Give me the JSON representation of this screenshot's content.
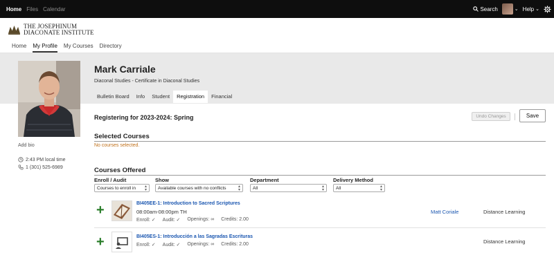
{
  "topbar": {
    "nav": [
      "Home",
      "Files",
      "Calendar"
    ],
    "search_label": "Search",
    "help_label": "Help"
  },
  "logo": {
    "line1": "THE JOSEPHINUM",
    "line2": "DIACONATE INSTITUTE"
  },
  "page_tabs": [
    "Home",
    "My Profile",
    "My Courses",
    "Directory"
  ],
  "profile": {
    "name": "Mark Carriale",
    "program": "Diaconal Studies - Certificate in Diaconal Studies",
    "add_bio": "Add bio",
    "local_time": "2:43 PM local time",
    "phone": "1 (301) 525-6989",
    "tabs": [
      "Bulletin Board",
      "Info",
      "Student",
      "Registration",
      "Financial"
    ]
  },
  "registration": {
    "title": "Registering for 2023-2024: Spring",
    "undo_label": "Undo Changes",
    "save_label": "Save",
    "selected_title": "Selected Courses",
    "no_courses": "No courses selected.",
    "offered_title": "Courses Offered"
  },
  "filters": {
    "enroll_label": "Enroll / Audit",
    "enroll_value": "Courses to enroll in",
    "show_label": "Show",
    "show_value": "Available courses with no conflicts",
    "department_label": "Department",
    "department_value": "All",
    "delivery_label": "Delivery Method",
    "delivery_value": "All"
  },
  "courses": [
    {
      "title": "BI405EE-1: Introduction to Sacred Scriptures",
      "time": "08:00am-08:00pm TH",
      "enroll": "Enroll: ✓",
      "audit": "Audit: ✓",
      "openings": "Openings: ∞",
      "credits": "Credits: 2.00",
      "instructor": "Matt Coriale",
      "delivery": "Distance Learning"
    },
    {
      "title": "BI405ES-1: Introducción a las Sagradas Escrituras",
      "enroll": "Enroll: ✓",
      "audit": "Audit: ✓",
      "openings": "Openings: ∞",
      "credits": "Credits: 2.00",
      "delivery": "Distance Learning"
    }
  ],
  "icons": {
    "search": "search-icon",
    "gear": "gear-icon",
    "clock": "clock-icon",
    "phone": "phone-icon",
    "add": "plus-icon",
    "presentation": "presentation-icon"
  },
  "colors": {
    "topbar": "#0e0e0e",
    "link": "#1a56b0",
    "warning": "#c0701a",
    "add": "#2a7d2a",
    "band": "#e9e9e9"
  }
}
